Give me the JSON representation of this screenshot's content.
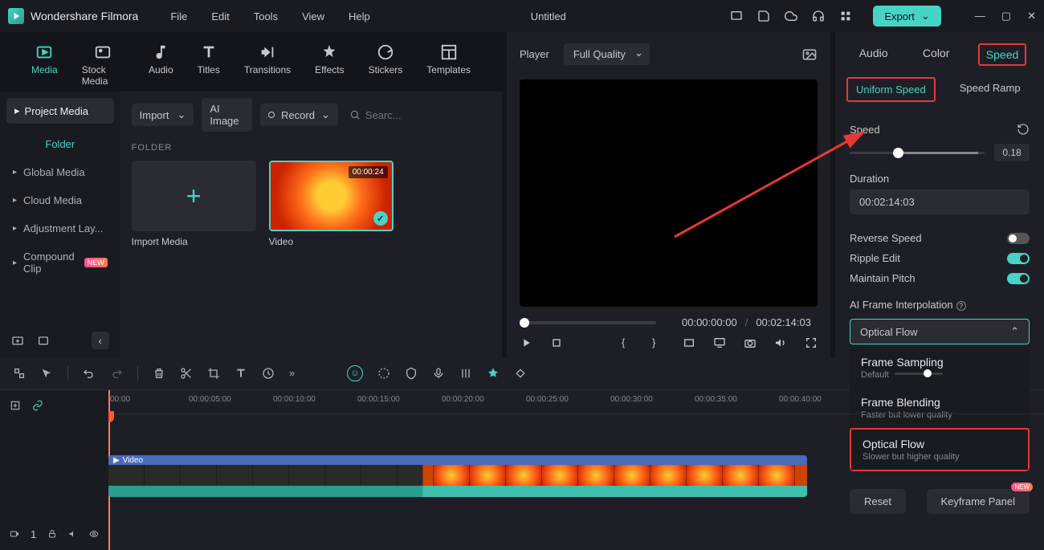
{
  "app": {
    "name": "Wondershare Filmora",
    "document": "Untitled",
    "export": "Export"
  },
  "menus": [
    "File",
    "Edit",
    "Tools",
    "View",
    "Help"
  ],
  "topTabs": [
    {
      "label": "Media",
      "active": true
    },
    {
      "label": "Stock Media"
    },
    {
      "label": "Audio"
    },
    {
      "label": "Titles"
    },
    {
      "label": "Transitions"
    },
    {
      "label": "Effects"
    },
    {
      "label": "Stickers"
    },
    {
      "label": "Templates"
    }
  ],
  "sidebar": {
    "header": "Project Media",
    "folder": "Folder",
    "items": [
      {
        "label": "Global Media"
      },
      {
        "label": "Cloud Media"
      },
      {
        "label": "Adjustment Lay..."
      },
      {
        "label": "Compound Clip",
        "new": true
      }
    ]
  },
  "contentBar": {
    "import": "Import",
    "ai": "AI Image",
    "record": "Record",
    "searchPlaceholder": "Searc..."
  },
  "folderSection": {
    "title": "FOLDER",
    "items": [
      {
        "label": "Import Media",
        "type": "add"
      },
      {
        "label": "Video",
        "type": "video",
        "duration": "00:00:24"
      }
    ]
  },
  "preview": {
    "label": "Player",
    "quality": "Full Quality",
    "current": "00:00:00:00",
    "total": "00:02:14:03"
  },
  "rightTabs": [
    {
      "label": "Audio"
    },
    {
      "label": "Color"
    },
    {
      "label": "Speed",
      "active": true
    }
  ],
  "speedSubTabs": [
    {
      "label": "Uniform Speed",
      "active": true
    },
    {
      "label": "Speed Ramp"
    }
  ],
  "speedPanel": {
    "speedLabel": "Speed",
    "speedValue": "0.18",
    "durationLabel": "Duration",
    "durationValue": "00:02:14:03",
    "reverse": "Reverse Speed",
    "ripple": "Ripple Edit",
    "pitch": "Maintain Pitch",
    "interp": "AI Frame Interpolation",
    "interpValue": "Optical Flow",
    "options": [
      {
        "title": "Frame Sampling",
        "sub": "Default"
      },
      {
        "title": "Frame Blending",
        "sub": "Faster but lower quality"
      },
      {
        "title": "Optical Flow",
        "sub": "Slower but higher quality",
        "selected": true
      }
    ],
    "reset": "Reset",
    "keyframe": "Keyframe Panel",
    "new": "NEW"
  },
  "timeline": {
    "ticks": [
      "00:00",
      "00:00:05:00",
      "00:00:10:00",
      "00:00:15:00",
      "00:00:20:00",
      "00:00:25:00",
      "00:00:30:00",
      "00:00:35:00",
      "00:00:40:00"
    ],
    "clipLabel": "Video"
  }
}
